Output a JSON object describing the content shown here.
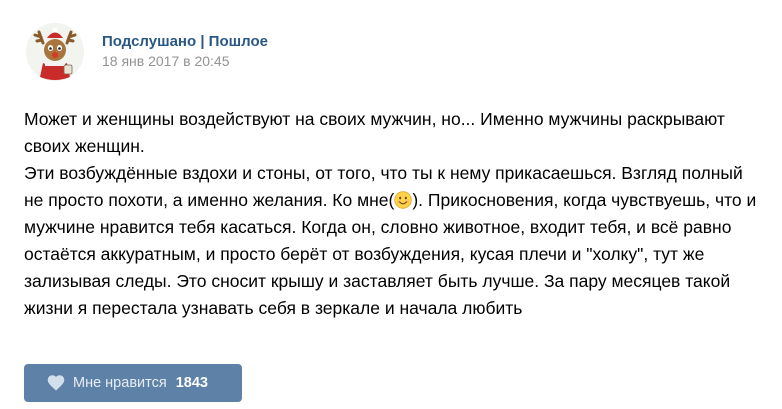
{
  "post": {
    "author": "Подслушано | Пошлое",
    "date": "18 янв 2017 в 20:45",
    "avatar_icon": "reindeer-avatar-icon",
    "text": {
      "line1": "Может и женщины воздействуют на своих мужчин, но... Именно мужчины раскрывают своих женщин.",
      "line2_before_emoji": "Эти возбуждённые вздохи и стоны, от того, что ты к нему прикасаешься. Взгляд полный не просто похоти, а именно желания. Ко мне(",
      "emoji_icon": "smiling-face-emoji-icon",
      "line2_after_emoji": "). Прикосновения, когда чувствуешь, что и мужчине нравится тебя касаться. Когда он, словно животное, входит тебя, и всё равно остаётся аккуратным, и просто берёт от возбуждения, кусая плечи и \"холку\", тут же зализывая следы. Это сносит крышу и заставляет быть лучше. За пару месяцев такой жизни я перестала узнавать себя в зеркале и начала любить"
    }
  },
  "like_button": {
    "label": "Мне нравится",
    "count": "1843",
    "icon": "heart-icon"
  },
  "colors": {
    "author_link": "#2a5885",
    "date": "#939393",
    "like_button_bg": "#5e81a8"
  }
}
